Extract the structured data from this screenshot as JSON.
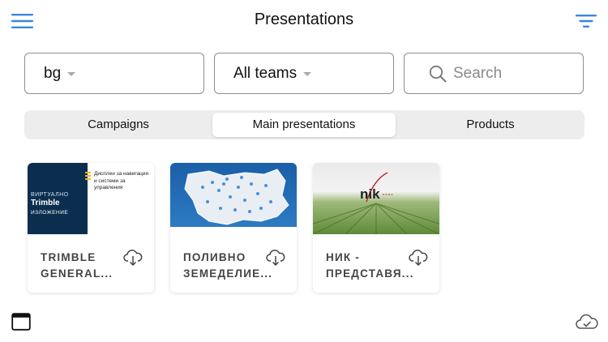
{
  "header": {
    "title": "Presentations",
    "menu_icon": "hamburger-menu-icon",
    "filter_icon": "filter-lines-icon"
  },
  "filters": {
    "language": "bg",
    "team": "All teams",
    "search_placeholder": "Search"
  },
  "tabs": [
    {
      "label": "Campaigns",
      "selected": false
    },
    {
      "label": "Main presentations",
      "selected": true
    },
    {
      "label": "Products",
      "selected": false
    }
  ],
  "presentations": [
    {
      "title_line1": "TRIMBLE",
      "title_line2": "GENERAL...",
      "thumb": {
        "line1": "ВИРТУАЛНО",
        "line2": "Trimble",
        "line3": "ИЗЛОЖЕНИЕ",
        "side_text": "Дисплеи за навигация и системи за управления"
      }
    },
    {
      "title_line1": "ПОЛИВНО",
      "title_line2": "ЗЕМЕДЕЛИЕ..."
    },
    {
      "title_line1": "НИК -",
      "title_line2": "ПРЕДСТАВЯ...",
      "thumb": {
        "logo": "nik"
      }
    }
  ],
  "bottom": {
    "left_icon": "window-icon",
    "right_icon": "cloud-check-icon"
  },
  "colors": {
    "accent": "#3a86e0",
    "card_title": "#444444",
    "segment_bg": "#ededed"
  }
}
